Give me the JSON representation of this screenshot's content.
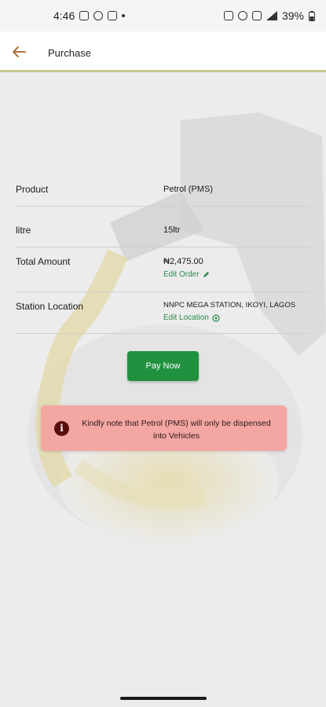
{
  "status": {
    "time": "4:46",
    "battery": "39%"
  },
  "header": {
    "title": "Purchase"
  },
  "order": {
    "product_label": "Product",
    "product_value": "Petrol (PMS)",
    "litre_label": "litre",
    "litre_value": "15ltr",
    "total_label": "Total Amount",
    "total_value": "₦2,475.00",
    "edit_order": "Edit Order",
    "station_label": "Station Location",
    "station_value": "NNPC MEGA STATION, IKOYI, LAGOS",
    "edit_location": "Edit Location"
  },
  "actions": {
    "pay_label": "Pay Now"
  },
  "notice": {
    "icon": "info-icon",
    "text": "Kindly note that Petrol (PMS) will only be dispensed into Vehicles"
  },
  "colors": {
    "primary_green": "#20913f",
    "link_green": "#2b8a4a",
    "notice_bg": "#f4a6a2",
    "back_arrow": "#a7733f"
  }
}
